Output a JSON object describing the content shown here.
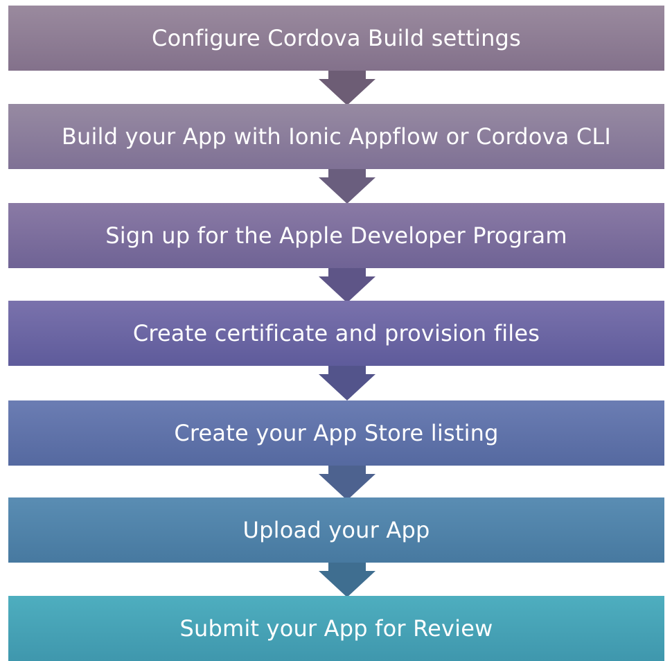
{
  "steps": [
    {
      "label": "Configure Cordova Build settings"
    },
    {
      "label": "Build your App with Ionic Appflow or Cordova CLI"
    },
    {
      "label": "Sign up for the Apple Developer Program"
    },
    {
      "label": "Create certificate and provision files"
    },
    {
      "label": "Create your App Store listing"
    },
    {
      "label": "Upload your App"
    },
    {
      "label": "Submit your App for Review"
    }
  ],
  "colors": {
    "arrows": [
      "#6d5d75",
      "#6a5e7e",
      "#5e5587",
      "#53548b",
      "#4d628f",
      "#3f6e90"
    ],
    "text": "#ffffff"
  }
}
